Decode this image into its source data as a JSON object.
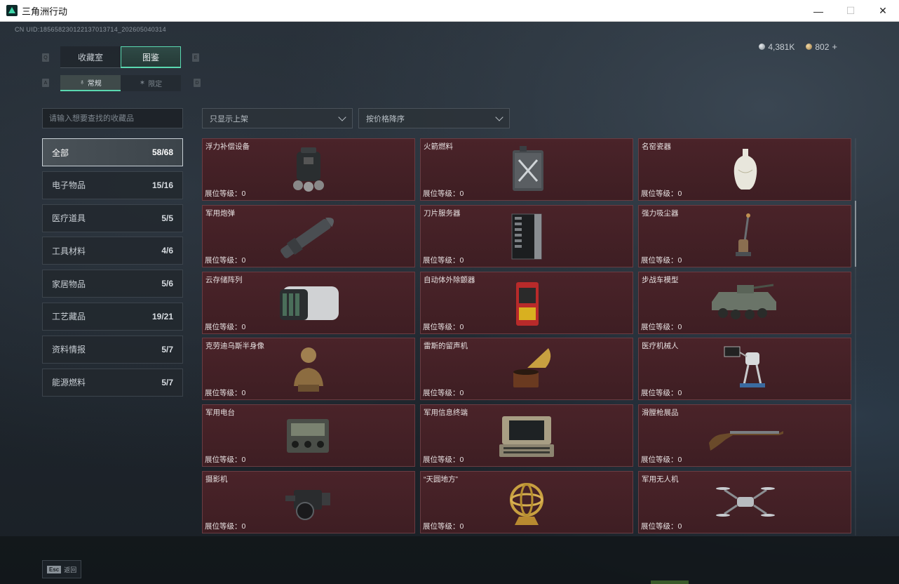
{
  "window": {
    "title": "三角洲行动",
    "minimize": "—",
    "maximize": "☐",
    "close": "✕"
  },
  "uid": "CN UID:1856582301221370137​14_202605040314",
  "currency": {
    "silver": "4,381K",
    "gold": "802",
    "plus": "+"
  },
  "keys": {
    "left_tab": "Q",
    "right_tab": "E",
    "left_sub": "A",
    "right_sub": "D"
  },
  "main_tabs": [
    "收藏室",
    "图鉴"
  ],
  "sub_tabs": {
    "normal": "常规",
    "limited": "限定",
    "normal_icon": "♁",
    "limited_icon": "✶"
  },
  "search": {
    "placeholder": "请输入想要查找的收藏品"
  },
  "filters": {
    "shelf": "只显示上架",
    "sort": "按价格降序"
  },
  "categories": [
    {
      "label": "全部",
      "count": "58/68"
    },
    {
      "label": "电子物品",
      "count": "15/16"
    },
    {
      "label": "医疗道具",
      "count": "5/5"
    },
    {
      "label": "工具材料",
      "count": "4/6"
    },
    {
      "label": "家居物品",
      "count": "5/6"
    },
    {
      "label": "工艺藏品",
      "count": "19/21"
    },
    {
      "label": "资料情报",
      "count": "5/7"
    },
    {
      "label": "能源燃料",
      "count": "5/7"
    }
  ],
  "items": [
    {
      "name": "浮力补偿设备",
      "level": "展位等级：0",
      "icon": "buoyancy-device-icon"
    },
    {
      "name": "火箭燃料",
      "level": "展位等级：0",
      "icon": "rocket-fuel-icon"
    },
    {
      "name": "名窑瓷器",
      "level": "展位等级：0",
      "icon": "porcelain-vase-icon"
    },
    {
      "name": "军用炮弹",
      "level": "展位等级：0",
      "icon": "artillery-shell-icon"
    },
    {
      "name": "刀片服务器",
      "level": "展位等级：0",
      "icon": "blade-server-icon"
    },
    {
      "name": "强力吸尘器",
      "level": "展位等级：0",
      "icon": "vacuum-cleaner-icon"
    },
    {
      "name": "云存储阵列",
      "level": "展位等级：0",
      "icon": "storage-array-icon"
    },
    {
      "name": "自动体外除颤器",
      "level": "展位等级：0",
      "icon": "defibrillator-icon"
    },
    {
      "name": "步战车模型",
      "level": "展位等级：0",
      "icon": "ifv-model-icon"
    },
    {
      "name": "克劳迪乌斯半身像",
      "level": "展位等级：0",
      "icon": "bust-statue-icon"
    },
    {
      "name": "雷斯的留声机",
      "level": "展位等级：0",
      "icon": "gramophone-icon"
    },
    {
      "name": "医疗机械人",
      "level": "展位等级：0",
      "icon": "medical-robot-icon"
    },
    {
      "name": "军用电台",
      "level": "展位等级：0",
      "icon": "military-radio-icon"
    },
    {
      "name": "军用信息终端",
      "level": "展位等级：0",
      "icon": "info-terminal-icon"
    },
    {
      "name": "滑膛枪展品",
      "level": "展位等级：0",
      "icon": "musket-icon"
    },
    {
      "name": "摄影机",
      "level": "展位等级：0",
      "icon": "camera-icon"
    },
    {
      "name": "“天圆地方”",
      "level": "展位等级：0",
      "icon": "armillary-sphere-icon"
    },
    {
      "name": "军用无人机",
      "level": "展位等级：0",
      "icon": "drone-icon"
    }
  ],
  "footer": {
    "esc_key": "Esc",
    "esc_label": "返回"
  },
  "colors": {
    "accent": "#5ad8b0",
    "card_bg": "#4a2329",
    "card_border": "#6a3c42"
  }
}
